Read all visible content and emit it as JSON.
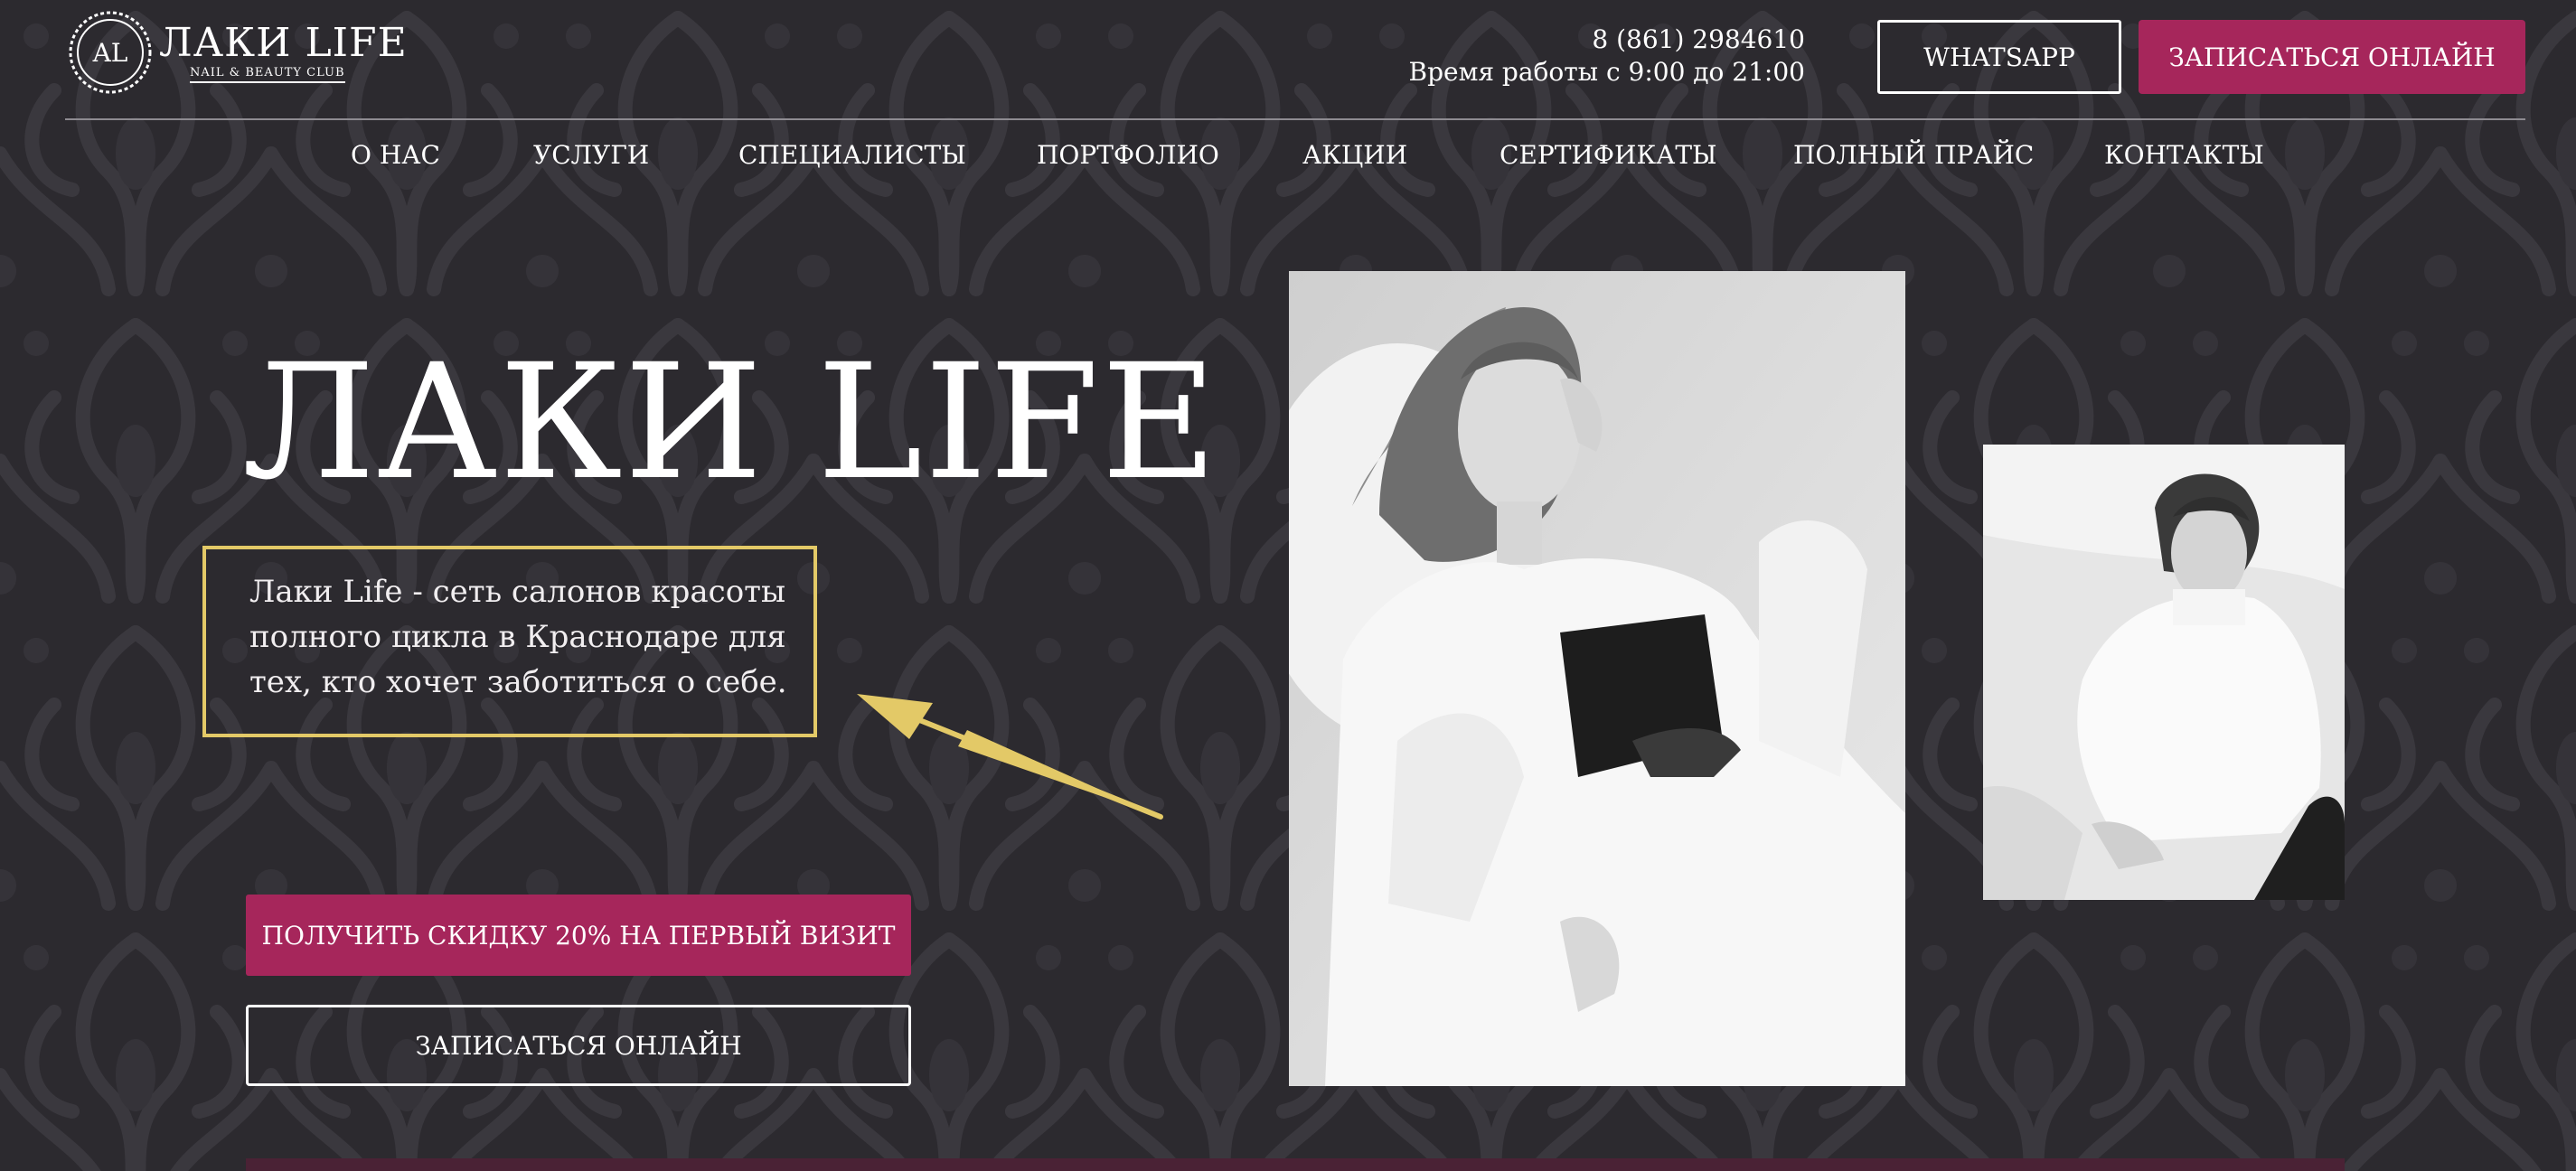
{
  "header": {
    "logo": {
      "monogram": "AL",
      "title": "ЛАКИ LIFE",
      "subtitle": "NAIL & BEAUTY CLUB"
    },
    "phone": "8 (861) 2984610",
    "hours": "Время работы с 9:00 до 21:00",
    "whatsapp_label": "WHATSAPP",
    "book_label": "ЗАПИСАТЬСЯ ОНЛАЙН"
  },
  "nav": {
    "items": [
      {
        "label": "О НАС"
      },
      {
        "label": "УСЛУГИ"
      },
      {
        "label": "СПЕЦИАЛИСТЫ"
      },
      {
        "label": "ПОРТФОЛИО"
      },
      {
        "label": "АКЦИИ"
      },
      {
        "label": "СЕРТИФИКАТЫ"
      },
      {
        "label": "ПОЛНЫЙ ПРАЙС"
      },
      {
        "label": "КОНТАКТЫ"
      }
    ]
  },
  "hero": {
    "title": "ЛАКИ LIFE",
    "description": "Лаки Life - сеть салонов красоты полного цикла в Краснодаре для тех, кто хочет заботиться о себе.",
    "discount_label": "ПОЛУЧИТЬ СКИДКУ 20% НА ПЕРВЫЙ ВИЗИТ",
    "online_label": "ЗАПИСАТЬСЯ ОНЛАЙН"
  },
  "colors": {
    "background": "#2c2a2f",
    "accent": "#a6265b",
    "highlight": "#e3c967"
  }
}
